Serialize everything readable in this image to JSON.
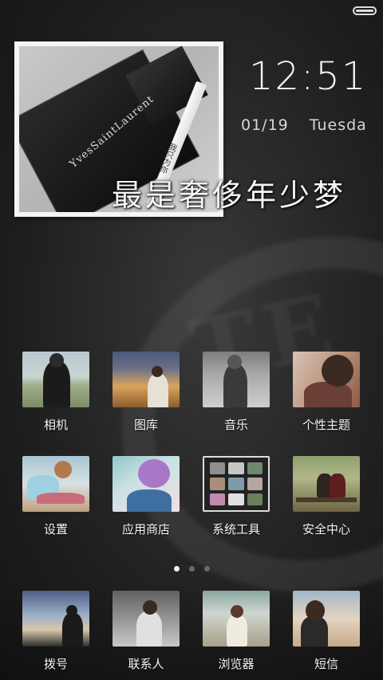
{
  "lockwidget": {
    "time": "12:51",
    "date": "01/19",
    "weekday": "Tuesda",
    "slogan": "最是奢侈年少梦",
    "photo_brand": "YvesSaintLaurent",
    "photo_cig_text": "我只为你"
  },
  "apps": [
    {
      "id": "camera",
      "label": "相机",
      "icon": "camera-photo-icon"
    },
    {
      "id": "gallery",
      "label": "图库",
      "icon": "gallery-photo-icon"
    },
    {
      "id": "music",
      "label": "音乐",
      "icon": "music-photo-icon"
    },
    {
      "id": "theme",
      "label": "个性主题",
      "icon": "theme-photo-icon"
    },
    {
      "id": "settings",
      "label": "设置",
      "icon": "settings-photo-icon"
    },
    {
      "id": "store",
      "label": "应用商店",
      "icon": "app-store-photo-icon"
    },
    {
      "id": "tools",
      "label": "系统工具",
      "icon": "system-tools-folder-icon"
    },
    {
      "id": "security",
      "label": "安全中心",
      "icon": "security-photo-icon"
    }
  ],
  "pager": {
    "pages": 3,
    "active": 0
  },
  "dock": [
    {
      "id": "dial",
      "label": "拨号",
      "icon": "dialer-photo-icon"
    },
    {
      "id": "contacts",
      "label": "联系人",
      "icon": "contacts-photo-icon"
    },
    {
      "id": "browser",
      "label": "浏览器",
      "icon": "browser-photo-icon"
    },
    {
      "id": "sms",
      "label": "短信",
      "icon": "sms-photo-icon"
    }
  ],
  "colors": {
    "background": "#222222",
    "label": "#f4f4f4",
    "date": "#cfd9e0",
    "frame": "#f4f4f4"
  }
}
